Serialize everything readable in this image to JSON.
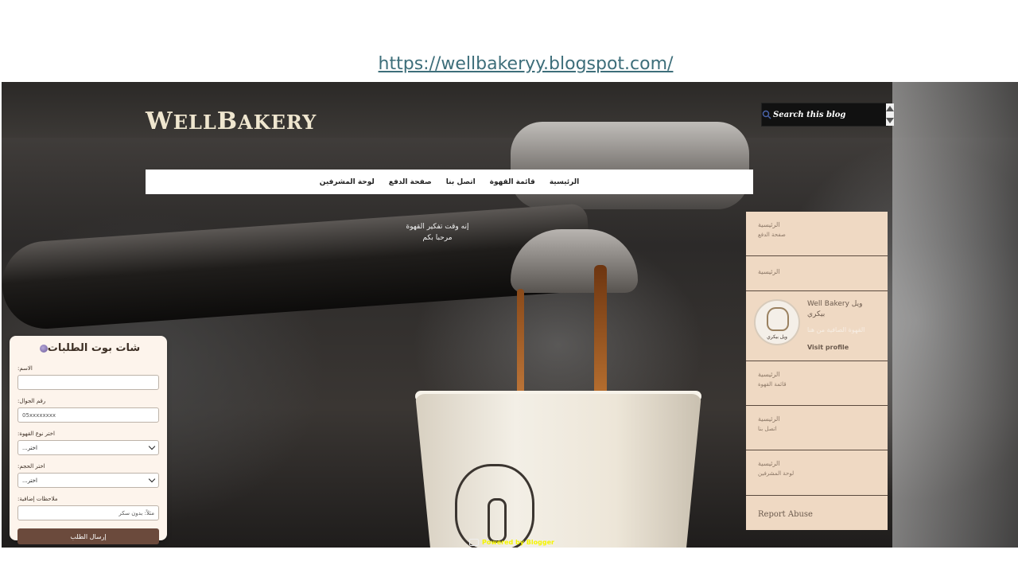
{
  "url": "https://wellbakeryy.blogspot.com/",
  "logo": {
    "first": "W",
    "rest1": "ELL",
    "mid": "B",
    "rest2": "AKERY"
  },
  "search": {
    "placeholder": "Search this blog"
  },
  "nav": {
    "items": [
      "الرئيسية",
      "قائمة القهوة",
      "اتصل بنا",
      "صفحة الدفع",
      "لوحة المشرفين"
    ]
  },
  "welcome": {
    "line1": "إنه وقت تفكير القهوة",
    "line2": "مرحبا بكم"
  },
  "sidebar": {
    "item1": {
      "title": "الرئيسية",
      "sub": "صفحة الدفع"
    },
    "item2": {
      "title": "الرئيسية"
    },
    "profile": {
      "name": "Well Bakery ويل بيكري",
      "desc": "القهوة الصافية من هنا",
      "link": "Visit profile",
      "avatar_text": "ويل بيكري"
    },
    "item3": {
      "title": "الرئيسية",
      "sub": "قائمة القهوة"
    },
    "item4": {
      "title": "الرئيسية",
      "sub": "اتصل بنا"
    },
    "item5": {
      "title": "الرئيسية",
      "sub": "لوحة المشرفين"
    },
    "report": "Report Abuse"
  },
  "chat": {
    "title": "شات بوت الطلبات",
    "name_label": ":الاسم",
    "phone_label": ":رقم الجوال",
    "phone_placeholder": "05xxxxxxxx",
    "coffee_label": ":اختر نوع القهوة",
    "coffee_value": "...اختر",
    "size_label": ":اختر الحجم",
    "size_value": "...اختر",
    "notes_label": ":ملاحظات إضافية",
    "notes_placeholder": "مثلاً: بدون سكر",
    "submit": "إرسال الطلب"
  },
  "footer": {
    "powered": "Powered by Blogger"
  },
  "colors": {
    "sidebar_bg": "#efd9c3",
    "button": "#6b4a3c",
    "link": "#3d6e7a"
  }
}
